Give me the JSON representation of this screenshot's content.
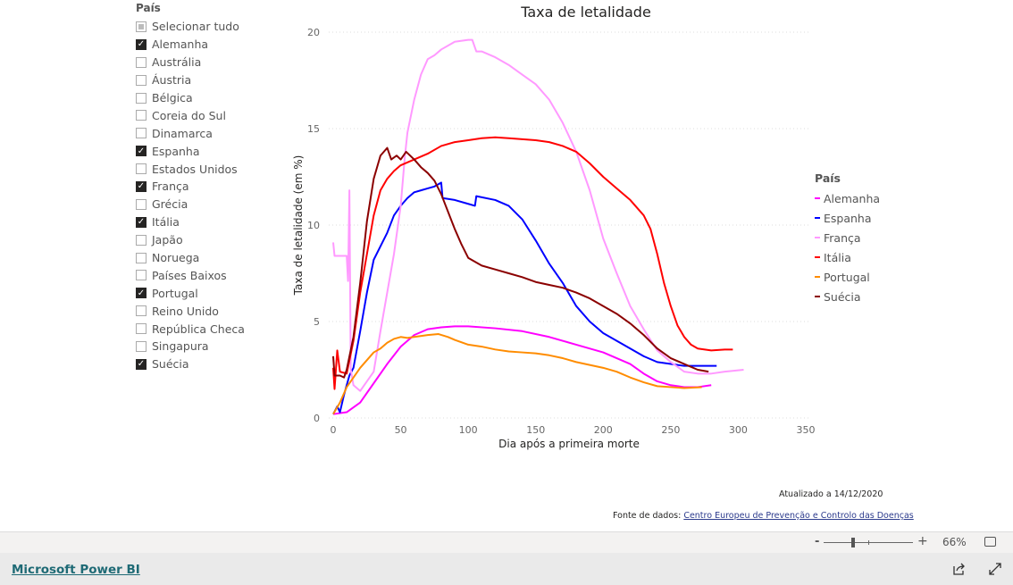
{
  "slicer": {
    "title": "País",
    "items": [
      {
        "label": "Selecionar tudo",
        "state": "partial"
      },
      {
        "label": "Alemanha",
        "state": "checked"
      },
      {
        "label": "Austrália",
        "state": "unchecked"
      },
      {
        "label": "Áustria",
        "state": "unchecked"
      },
      {
        "label": "Bélgica",
        "state": "unchecked"
      },
      {
        "label": "Coreia do Sul",
        "state": "unchecked"
      },
      {
        "label": "Dinamarca",
        "state": "unchecked"
      },
      {
        "label": "Espanha",
        "state": "checked"
      },
      {
        "label": "Estados Unidos",
        "state": "unchecked"
      },
      {
        "label": "França",
        "state": "checked"
      },
      {
        "label": "Grécia",
        "state": "unchecked"
      },
      {
        "label": "Itália",
        "state": "checked"
      },
      {
        "label": "Japão",
        "state": "unchecked"
      },
      {
        "label": "Noruega",
        "state": "unchecked"
      },
      {
        "label": "Países Baixos",
        "state": "unchecked"
      },
      {
        "label": "Portugal",
        "state": "checked"
      },
      {
        "label": "Reino Unido",
        "state": "unchecked"
      },
      {
        "label": "República Checa",
        "state": "unchecked"
      },
      {
        "label": "Singapura",
        "state": "unchecked"
      },
      {
        "label": "Suécia",
        "state": "checked"
      }
    ]
  },
  "chart_data": {
    "type": "line",
    "title": "Taxa de letalidade",
    "xlabel": "Dia após a primeira morte",
    "ylabel": "Taxa de letalidade (em %)",
    "xlim": [
      0,
      350
    ],
    "ylim": [
      0,
      20
    ],
    "xticks": [
      0,
      50,
      100,
      150,
      200,
      250,
      300,
      350
    ],
    "yticks": [
      0,
      5,
      10,
      15,
      20
    ],
    "grid": "horizontal dotted",
    "legend": {
      "title": "País",
      "placement": "right"
    },
    "series": [
      {
        "name": "Alemanha",
        "color": "#ff00ff",
        "points": [
          [
            0,
            0.2
          ],
          [
            10,
            0.3
          ],
          [
            20,
            0.8
          ],
          [
            30,
            1.8
          ],
          [
            40,
            2.8
          ],
          [
            50,
            3.7
          ],
          [
            60,
            4.3
          ],
          [
            70,
            4.6
          ],
          [
            80,
            4.7
          ],
          [
            90,
            4.75
          ],
          [
            100,
            4.75
          ],
          [
            120,
            4.65
          ],
          [
            140,
            4.5
          ],
          [
            160,
            4.2
          ],
          [
            180,
            3.8
          ],
          [
            200,
            3.4
          ],
          [
            210,
            3.1
          ],
          [
            220,
            2.8
          ],
          [
            230,
            2.3
          ],
          [
            240,
            1.9
          ],
          [
            250,
            1.7
          ],
          [
            260,
            1.6
          ],
          [
            270,
            1.6
          ],
          [
            280,
            1.7
          ]
        ]
      },
      {
        "name": "Espanha",
        "color": "#0000ff",
        "points": [
          [
            0,
            0.2
          ],
          [
            3,
            0.6
          ],
          [
            5,
            0.3
          ],
          [
            8,
            1.2
          ],
          [
            12,
            2.2
          ],
          [
            15,
            2.6
          ],
          [
            20,
            4.5
          ],
          [
            25,
            6.5
          ],
          [
            30,
            8.2
          ],
          [
            40,
            9.6
          ],
          [
            45,
            10.5
          ],
          [
            50,
            11.0
          ],
          [
            55,
            11.4
          ],
          [
            60,
            11.7
          ],
          [
            65,
            11.8
          ],
          [
            70,
            11.9
          ],
          [
            75,
            12.0
          ],
          [
            80,
            12.2
          ],
          [
            81,
            11.4
          ],
          [
            90,
            11.3
          ],
          [
            100,
            11.1
          ],
          [
            105,
            11.0
          ],
          [
            106,
            11.5
          ],
          [
            120,
            11.3
          ],
          [
            130,
            11.0
          ],
          [
            140,
            10.3
          ],
          [
            150,
            9.2
          ],
          [
            160,
            8.0
          ],
          [
            170,
            7.0
          ],
          [
            175,
            6.4
          ],
          [
            180,
            5.8
          ],
          [
            190,
            5.0
          ],
          [
            200,
            4.4
          ],
          [
            210,
            4.0
          ],
          [
            220,
            3.6
          ],
          [
            230,
            3.2
          ],
          [
            240,
            2.9
          ],
          [
            250,
            2.8
          ],
          [
            260,
            2.7
          ],
          [
            270,
            2.7
          ],
          [
            284,
            2.7
          ]
        ]
      },
      {
        "name": "França",
        "color": "#ff99ff",
        "points": [
          [
            0,
            9.1
          ],
          [
            1,
            8.4
          ],
          [
            10,
            8.4
          ],
          [
            11,
            7.1
          ],
          [
            12,
            11.8
          ],
          [
            13,
            2.5
          ],
          [
            15,
            1.7
          ],
          [
            20,
            1.4
          ],
          [
            25,
            1.9
          ],
          [
            30,
            2.4
          ],
          [
            35,
            4.5
          ],
          [
            40,
            6.5
          ],
          [
            45,
            8.5
          ],
          [
            50,
            11
          ],
          [
            53,
            13.5
          ],
          [
            55,
            14.8
          ],
          [
            60,
            16.5
          ],
          [
            65,
            17.8
          ],
          [
            70,
            18.6
          ],
          [
            75,
            18.8
          ],
          [
            80,
            19.1
          ],
          [
            90,
            19.5
          ],
          [
            100,
            19.6
          ],
          [
            103,
            19.6
          ],
          [
            106,
            19.0
          ],
          [
            110,
            19.0
          ],
          [
            120,
            18.7
          ],
          [
            130,
            18.3
          ],
          [
            140,
            17.8
          ],
          [
            150,
            17.3
          ],
          [
            160,
            16.5
          ],
          [
            170,
            15.3
          ],
          [
            180,
            13.8
          ],
          [
            190,
            11.8
          ],
          [
            200,
            9.3
          ],
          [
            210,
            7.5
          ],
          [
            220,
            5.8
          ],
          [
            230,
            4.6
          ],
          [
            240,
            3.5
          ],
          [
            250,
            2.9
          ],
          [
            260,
            2.4
          ],
          [
            270,
            2.3
          ],
          [
            280,
            2.3
          ],
          [
            290,
            2.4
          ],
          [
            304,
            2.5
          ]
        ]
      },
      {
        "name": "Itália",
        "color": "#ff0000",
        "points": [
          [
            0,
            2.6
          ],
          [
            1,
            1.5
          ],
          [
            3,
            3.5
          ],
          [
            5,
            2.4
          ],
          [
            10,
            2.3
          ],
          [
            15,
            4
          ],
          [
            20,
            6.5
          ],
          [
            25,
            8.5
          ],
          [
            30,
            10.5
          ],
          [
            35,
            11.8
          ],
          [
            40,
            12.4
          ],
          [
            45,
            12.8
          ],
          [
            50,
            13.1
          ],
          [
            60,
            13.4
          ],
          [
            70,
            13.7
          ],
          [
            80,
            14.1
          ],
          [
            90,
            14.3
          ],
          [
            100,
            14.4
          ],
          [
            110,
            14.5
          ],
          [
            120,
            14.55
          ],
          [
            130,
            14.5
          ],
          [
            140,
            14.45
          ],
          [
            150,
            14.4
          ],
          [
            160,
            14.3
          ],
          [
            170,
            14.1
          ],
          [
            180,
            13.8
          ],
          [
            190,
            13.2
          ],
          [
            200,
            12.5
          ],
          [
            210,
            11.9
          ],
          [
            220,
            11.3
          ],
          [
            230,
            10.5
          ],
          [
            235,
            9.8
          ],
          [
            240,
            8.5
          ],
          [
            245,
            7.0
          ],
          [
            250,
            5.8
          ],
          [
            255,
            4.8
          ],
          [
            260,
            4.2
          ],
          [
            265,
            3.8
          ],
          [
            270,
            3.6
          ],
          [
            280,
            3.5
          ],
          [
            290,
            3.55
          ],
          [
            296,
            3.55
          ]
        ]
      },
      {
        "name": "Portugal",
        "color": "#ff8c00",
        "points": [
          [
            0,
            0.2
          ],
          [
            5,
            0.8
          ],
          [
            10,
            1.6
          ],
          [
            15,
            2.1
          ],
          [
            20,
            2.6
          ],
          [
            25,
            3.0
          ],
          [
            30,
            3.4
          ],
          [
            35,
            3.6
          ],
          [
            40,
            3.9
          ],
          [
            45,
            4.1
          ],
          [
            50,
            4.2
          ],
          [
            55,
            4.15
          ],
          [
            60,
            4.2
          ],
          [
            70,
            4.3
          ],
          [
            78,
            4.35
          ],
          [
            85,
            4.2
          ],
          [
            90,
            4.05
          ],
          [
            100,
            3.8
          ],
          [
            110,
            3.7
          ],
          [
            120,
            3.55
          ],
          [
            130,
            3.45
          ],
          [
            140,
            3.4
          ],
          [
            150,
            3.35
          ],
          [
            160,
            3.25
          ],
          [
            170,
            3.1
          ],
          [
            180,
            2.9
          ],
          [
            190,
            2.75
          ],
          [
            200,
            2.6
          ],
          [
            210,
            2.4
          ],
          [
            220,
            2.1
          ],
          [
            230,
            1.85
          ],
          [
            240,
            1.65
          ],
          [
            250,
            1.6
          ],
          [
            260,
            1.55
          ],
          [
            273,
            1.6
          ]
        ]
      },
      {
        "name": "Suécia",
        "color": "#8b0000",
        "points": [
          [
            0,
            3.2
          ],
          [
            1,
            2.2
          ],
          [
            5,
            2.2
          ],
          [
            8,
            2.1
          ],
          [
            10,
            2.5
          ],
          [
            15,
            4.2
          ],
          [
            20,
            7.0
          ],
          [
            25,
            10.2
          ],
          [
            30,
            12.4
          ],
          [
            35,
            13.6
          ],
          [
            40,
            14.0
          ],
          [
            43,
            13.4
          ],
          [
            47,
            13.6
          ],
          [
            50,
            13.4
          ],
          [
            54,
            13.8
          ],
          [
            60,
            13.4
          ],
          [
            65,
            13.0
          ],
          [
            70,
            12.7
          ],
          [
            75,
            12.3
          ],
          [
            80,
            11.6
          ],
          [
            85,
            10.7
          ],
          [
            90,
            9.8
          ],
          [
            95,
            9.0
          ],
          [
            100,
            8.3
          ],
          [
            110,
            7.9
          ],
          [
            120,
            7.7
          ],
          [
            130,
            7.5
          ],
          [
            140,
            7.3
          ],
          [
            150,
            7.05
          ],
          [
            160,
            6.9
          ],
          [
            170,
            6.75
          ],
          [
            180,
            6.5
          ],
          [
            190,
            6.2
          ],
          [
            200,
            5.8
          ],
          [
            210,
            5.4
          ],
          [
            220,
            4.9
          ],
          [
            230,
            4.3
          ],
          [
            240,
            3.6
          ],
          [
            250,
            3.1
          ],
          [
            260,
            2.8
          ],
          [
            270,
            2.5
          ],
          [
            278,
            2.4
          ]
        ]
      }
    ]
  },
  "footer": {
    "updated_label": "Atualizado a  14/12/2020",
    "source_label": "Fonte de dados: ",
    "source_link": "Centro Europeu de Prevenção e Controlo das Doenças"
  },
  "zoom": {
    "minus": "-",
    "plus": "+",
    "level": "66%"
  },
  "bottom": {
    "brand": "Microsoft Power BI"
  }
}
